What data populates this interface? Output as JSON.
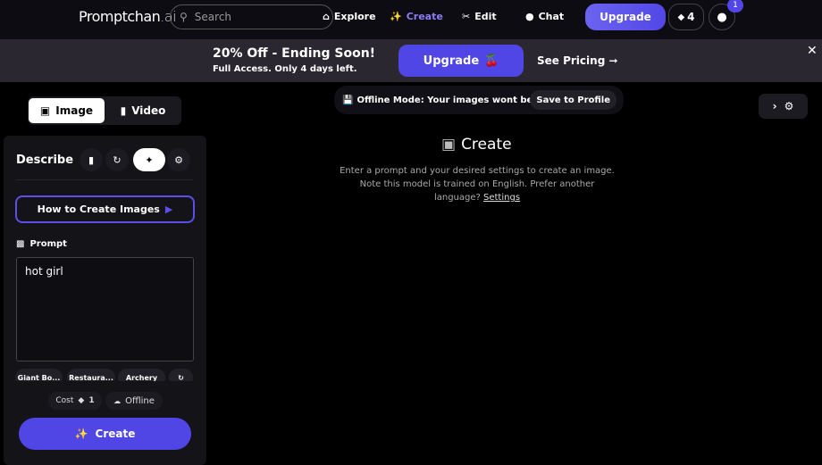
{
  "nav": {
    "logo_main": "Promptchan",
    "logo_suffix": ".ai",
    "search_placeholder": "Search",
    "items": [
      {
        "label": "Explore",
        "icon": "home-icon"
      },
      {
        "label": "Create",
        "icon": "magic-wand-icon",
        "active": true
      },
      {
        "label": "Edit",
        "icon": "scissors-icon"
      },
      {
        "label": "Chat",
        "icon": "chat-icon"
      }
    ],
    "upgrade": "Upgrade",
    "gems": "4",
    "notifications": "1"
  },
  "banner": {
    "title": "20% Off - Ending Soon!",
    "subtitle": "Full Access. Only 4 days left.",
    "upgrade": "Upgrade",
    "cherry": "🍒",
    "pricing": "See Pricing ➞"
  },
  "modes": {
    "image": "Image",
    "video": "Video"
  },
  "panel": {
    "describe": "Describe",
    "how_to": "How to Create Images",
    "prompt_label": "Prompt",
    "prompt_value": "hot girl",
    "chips": [
      "Giant Bo...",
      "Restaura...",
      "Archery"
    ],
    "cost_label": "Cost",
    "cost_value": "1",
    "offline": "Offline",
    "create": "Create"
  },
  "main": {
    "offline_msg": "Offline Mode: Your images wont be saved!",
    "save_profile": "Save to Profile",
    "title": "Create",
    "desc": "Enter a prompt and your desired settings to create an image. Note this model is trained on English. Prefer another language?",
    "settings_link": "Settings"
  },
  "colors": {
    "accent": "#5046e5",
    "create_active": "#8b7ff5"
  }
}
